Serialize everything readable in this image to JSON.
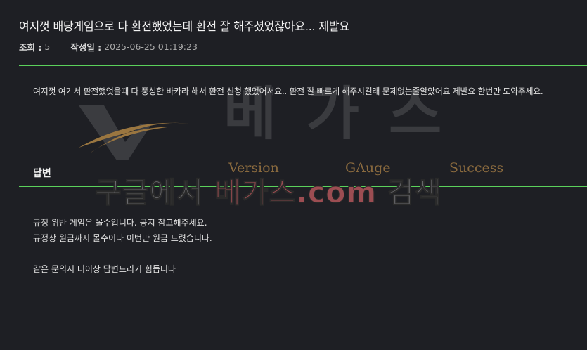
{
  "post": {
    "title": "여지껏 배당게임으로 다 환전했었는데 환전 잘 해주셨었잖아요... 제발요",
    "views_label": "조회 :",
    "views_value": "5",
    "date_label": "작성일 :",
    "date_value": "2025-06-25 01:19:23",
    "body": "여지껏 여기서 환전했엇을때 다 풍성한 바카라 해서 환전 신청 했었어서요.. 환전 잘 빠르게 해주시길래 문제없는줄알았어요 제발요 한번만 도와주세요."
  },
  "answer": {
    "heading": "답변",
    "lines": [
      "규정 위반 게임은 몰수입니다. 공지 참고해주세요.",
      "규정상 원금까지 몰수이나 이번만 원금 드렸습니다.",
      "같은 문의시 더이상 답변드리기 힘듭니다"
    ]
  },
  "watermark": {
    "korean_title": "베가스",
    "words": [
      "Version",
      "GAuge",
      "Success"
    ],
    "search_prefix": "구글에서 ",
    "search_site": "베가스.com",
    "search_suffix": " 검색"
  },
  "colors": {
    "background": "#1e1f24",
    "divider": "#5bd15b",
    "watermark_gold": "#8a6a3e",
    "watermark_red": "#9c4d52"
  }
}
